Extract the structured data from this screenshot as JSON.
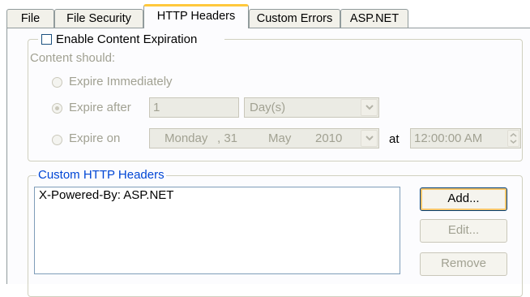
{
  "tabs": [
    {
      "label": "File"
    },
    {
      "label": "File Security"
    },
    {
      "label": "HTTP Headers",
      "active": true
    },
    {
      "label": "Custom Errors"
    },
    {
      "label": "ASP.NET"
    }
  ],
  "expiration": {
    "enable_label": "Enable Content Expiration",
    "enabled": false,
    "content_should_label": "Content should:",
    "option_immediately": "Expire Immediately",
    "option_after": "Expire after",
    "option_on": "Expire on",
    "selected_option": "Expire after",
    "after_value": "1",
    "after_unit": "Day(s)",
    "date": {
      "weekday": "Monday",
      "day": ", 31",
      "month": "May",
      "year": "2010"
    },
    "at_label": "at",
    "time": "12:00:00 AM"
  },
  "custom_headers": {
    "legend": "Custom HTTP Headers",
    "items": [
      "X-Powered-By: ASP.NET"
    ],
    "add_label": "Add...",
    "edit_label": "Edit...",
    "remove_label": "Remove"
  }
}
